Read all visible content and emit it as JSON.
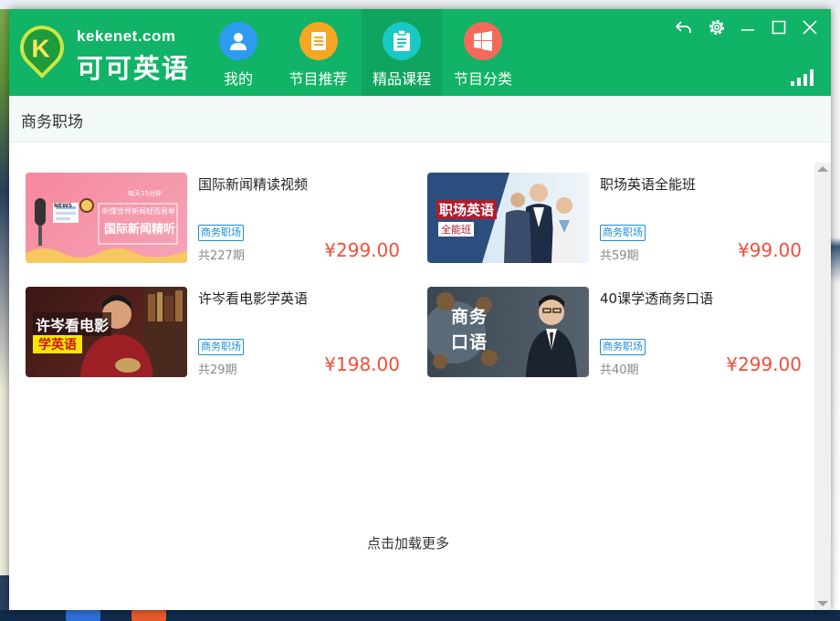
{
  "app": {
    "logo_url": "kekenet.com",
    "logo_name": "可可英语"
  },
  "nav": [
    {
      "label": "我的",
      "icon": "user-icon",
      "color": "#2e9bf0"
    },
    {
      "label": "节目推荐",
      "icon": "document-icon",
      "color": "#f5a623"
    },
    {
      "label": "精品课程",
      "icon": "clipboard-icon",
      "color": "#18c9c4"
    },
    {
      "label": "节目分类",
      "icon": "windows-grid-icon",
      "color": "#f36a5a"
    }
  ],
  "active_nav": "精品课程",
  "window_controls": [
    "back-icon",
    "settings-icon",
    "minimize-icon",
    "maximize-icon",
    "close-icon"
  ],
  "section_title": "商务职场",
  "courses": [
    {
      "title": "国际新闻精读视频",
      "tag": "商务职场",
      "count": "共227期",
      "price": "¥299.00",
      "thumb_text": [
        "每天15分钟",
        "听懂世界新闻轻而易举",
        "国际新闻精听",
        "NEWS"
      ]
    },
    {
      "title": "职场英语全能班",
      "tag": "商务职场",
      "count": "共59期",
      "price": "¥99.00",
      "thumb_text": [
        "职场英语",
        "全能班"
      ]
    },
    {
      "title": "许岑看电影学英语",
      "tag": "商务职场",
      "count": "共29期",
      "price": "¥198.00",
      "thumb_text": [
        "许岑看电影",
        "学英语"
      ]
    },
    {
      "title": "40课学透商务口语",
      "tag": "商务职场",
      "count": "共40期",
      "price": "¥299.00",
      "thumb_text": [
        "商务",
        "口语"
      ]
    }
  ],
  "load_more": "点击加载更多",
  "colors": {
    "header_green": "#11b366",
    "price_red": "#f24e3b",
    "tag_blue": "#1a8dd8"
  }
}
